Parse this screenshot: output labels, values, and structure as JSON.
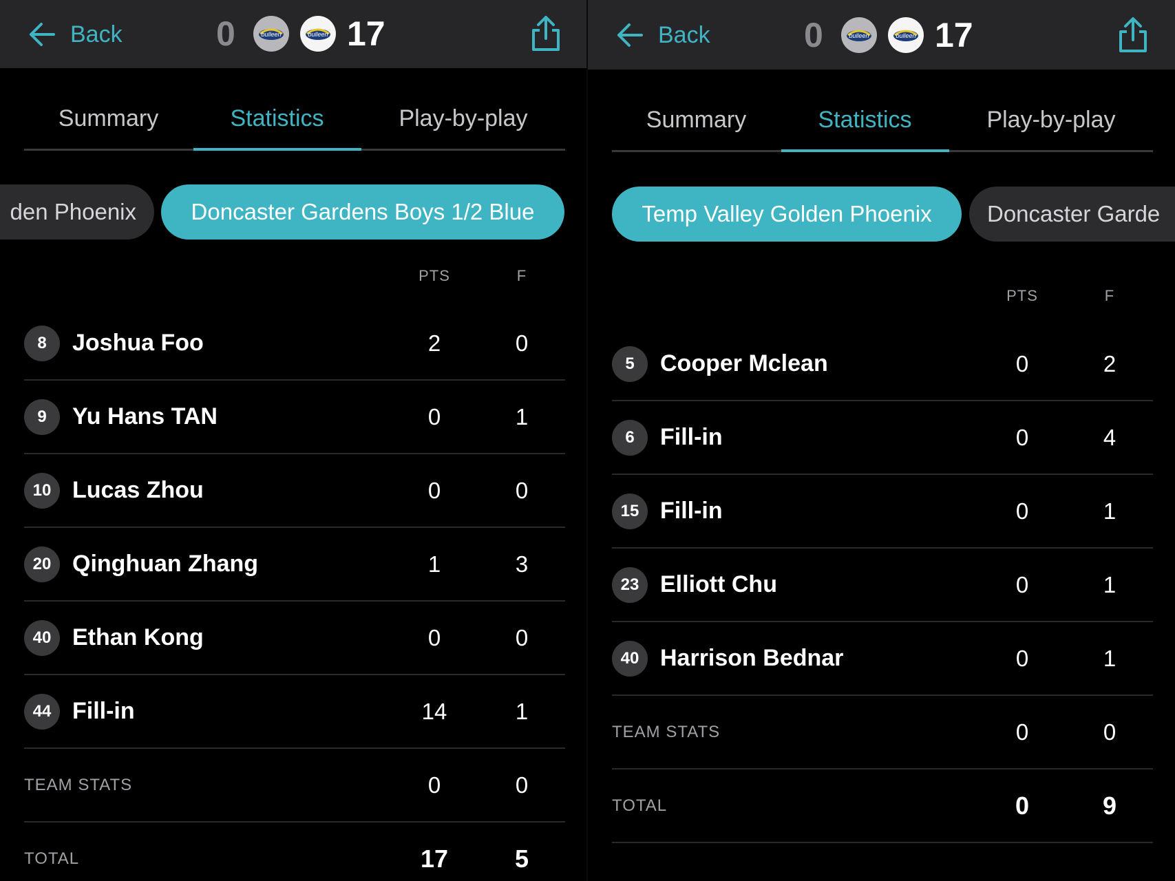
{
  "header": {
    "back_label": "Back",
    "home_score": "0",
    "away_score": "17",
    "home_logo_text": "bulleen",
    "away_logo_text": "bulleen"
  },
  "tabs": [
    "Summary",
    "Statistics",
    "Play-by-play"
  ],
  "active_tab": "Statistics",
  "columns": {
    "pts": "PTS",
    "f": "F"
  },
  "left_panel": {
    "teams": [
      "Temp Valley Golden Phoenix",
      "Doncaster Gardens Boys 1/2 Blue"
    ],
    "visible_inactive_team_text": "den Phoenix",
    "active_team": "Doncaster Gardens Boys 1/2 Blue",
    "players": [
      {
        "number": "8",
        "name": "Joshua Foo",
        "pts": "2",
        "f": "0"
      },
      {
        "number": "9",
        "name": "Yu Hans TAN",
        "pts": "0",
        "f": "1"
      },
      {
        "number": "10",
        "name": "Lucas Zhou",
        "pts": "0",
        "f": "0"
      },
      {
        "number": "20",
        "name": "Qinghuan Zhang",
        "pts": "1",
        "f": "3"
      },
      {
        "number": "40",
        "name": "Ethan Kong",
        "pts": "0",
        "f": "0"
      },
      {
        "number": "44",
        "name": "Fill-in",
        "pts": "14",
        "f": "1"
      }
    ],
    "team_stats": {
      "label": "TEAM STATS",
      "pts": "0",
      "f": "0"
    },
    "total": {
      "label": "TOTAL",
      "pts": "17",
      "f": "5"
    }
  },
  "right_panel": {
    "teams": [
      "Temp Valley Golden Phoenix",
      "Doncaster Gardens Boys 1/2 Blue"
    ],
    "visible_inactive_team_text": "Doncaster Garde",
    "active_team": "Temp Valley Golden Phoenix",
    "players": [
      {
        "number": "5",
        "name": "Cooper Mclean",
        "pts": "0",
        "f": "2"
      },
      {
        "number": "6",
        "name": "Fill-in",
        "pts": "0",
        "f": "4"
      },
      {
        "number": "15",
        "name": "Fill-in",
        "pts": "0",
        "f": "1"
      },
      {
        "number": "23",
        "name": "Elliott Chu",
        "pts": "0",
        "f": "1"
      },
      {
        "number": "40",
        "name": "Harrison Bednar",
        "pts": "0",
        "f": "1"
      }
    ],
    "team_stats": {
      "label": "TEAM STATS",
      "pts": "0",
      "f": "0"
    },
    "total": {
      "label": "TOTAL",
      "pts": "0",
      "f": "9"
    }
  },
  "colors": {
    "accent": "#3fb5c4",
    "topbar": "#262628",
    "pill_inactive": "#2c2c2e",
    "badge": "#3a3a3c"
  }
}
